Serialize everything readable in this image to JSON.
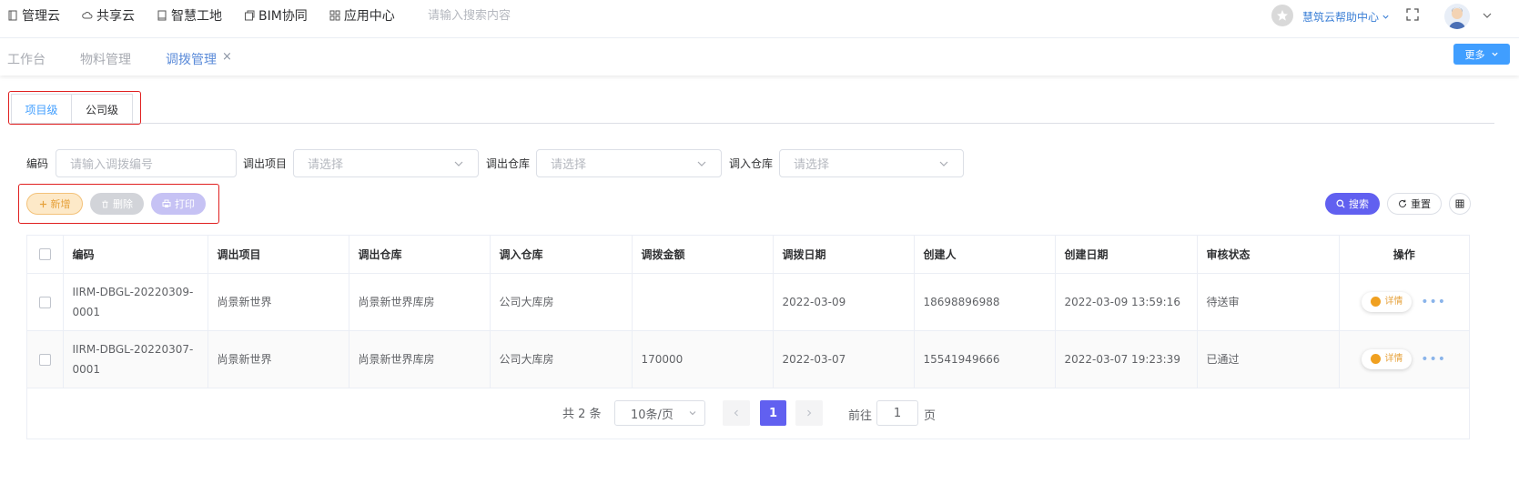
{
  "topnav": [
    {
      "label": "管理云",
      "icon": "document-icon"
    },
    {
      "label": "共享云",
      "icon": "cloud-icon"
    },
    {
      "label": "智慧工地",
      "icon": "book-icon"
    },
    {
      "label": "BIM协同",
      "icon": "cube-icon"
    },
    {
      "label": "应用中心",
      "icon": "grid-icon"
    }
  ],
  "search": {
    "placeholder": "请输入搜索内容"
  },
  "help": {
    "label": "慧筑云帮助中心"
  },
  "tabs": {
    "workbench": "工作台",
    "materials": "物料管理",
    "transfer": "调拨管理",
    "close": "×"
  },
  "more_button": "更多",
  "level_tabs": {
    "project": "项目级",
    "company": "公司级"
  },
  "filters": {
    "code_label": "编码",
    "code_placeholder": "请输入调拨编号",
    "out_project_label": "调出项目",
    "out_project_placeholder": "请选择",
    "out_warehouse_label": "调出仓库",
    "out_warehouse_placeholder": "请选择",
    "in_warehouse_label": "调入仓库",
    "in_warehouse_placeholder": "请选择"
  },
  "actions": {
    "add": "新增",
    "delete": "删除",
    "print": "打印",
    "search": "搜索",
    "reset": "重置"
  },
  "table": {
    "headers": [
      "编码",
      "调出项目",
      "调出仓库",
      "调入仓库",
      "调拨金额",
      "调拨日期",
      "创建人",
      "创建日期",
      "审核状态",
      "操作"
    ],
    "detail_label": "详情",
    "rows": [
      {
        "code": "IIRM-DBGL-20220309-0001",
        "out_project": "尚景新世界",
        "out_warehouse": "尚景新世界库房",
        "in_warehouse": "公司大库房",
        "amount": "",
        "date": "2022-03-09",
        "creator": "18698896988",
        "created": "2022-03-09 13:59:16",
        "status": "待送审"
      },
      {
        "code": "IIRM-DBGL-20220307-0001",
        "out_project": "尚景新世界",
        "out_warehouse": "尚景新世界库房",
        "in_warehouse": "公司大库房",
        "amount": "170000",
        "date": "2022-03-07",
        "creator": "15541949666",
        "created": "2022-03-07 19:23:39",
        "status": "已通过"
      }
    ]
  },
  "pagination": {
    "total": "共 2 条",
    "page_size": "10条/页",
    "current": "1",
    "goto_label": "前往",
    "goto_value": "1",
    "goto_suffix": "页"
  },
  "colors": {
    "primary": "#6160f0",
    "accent_blue": "#409eff",
    "highlight_red": "#e02020",
    "warning": "#e6a23c"
  }
}
